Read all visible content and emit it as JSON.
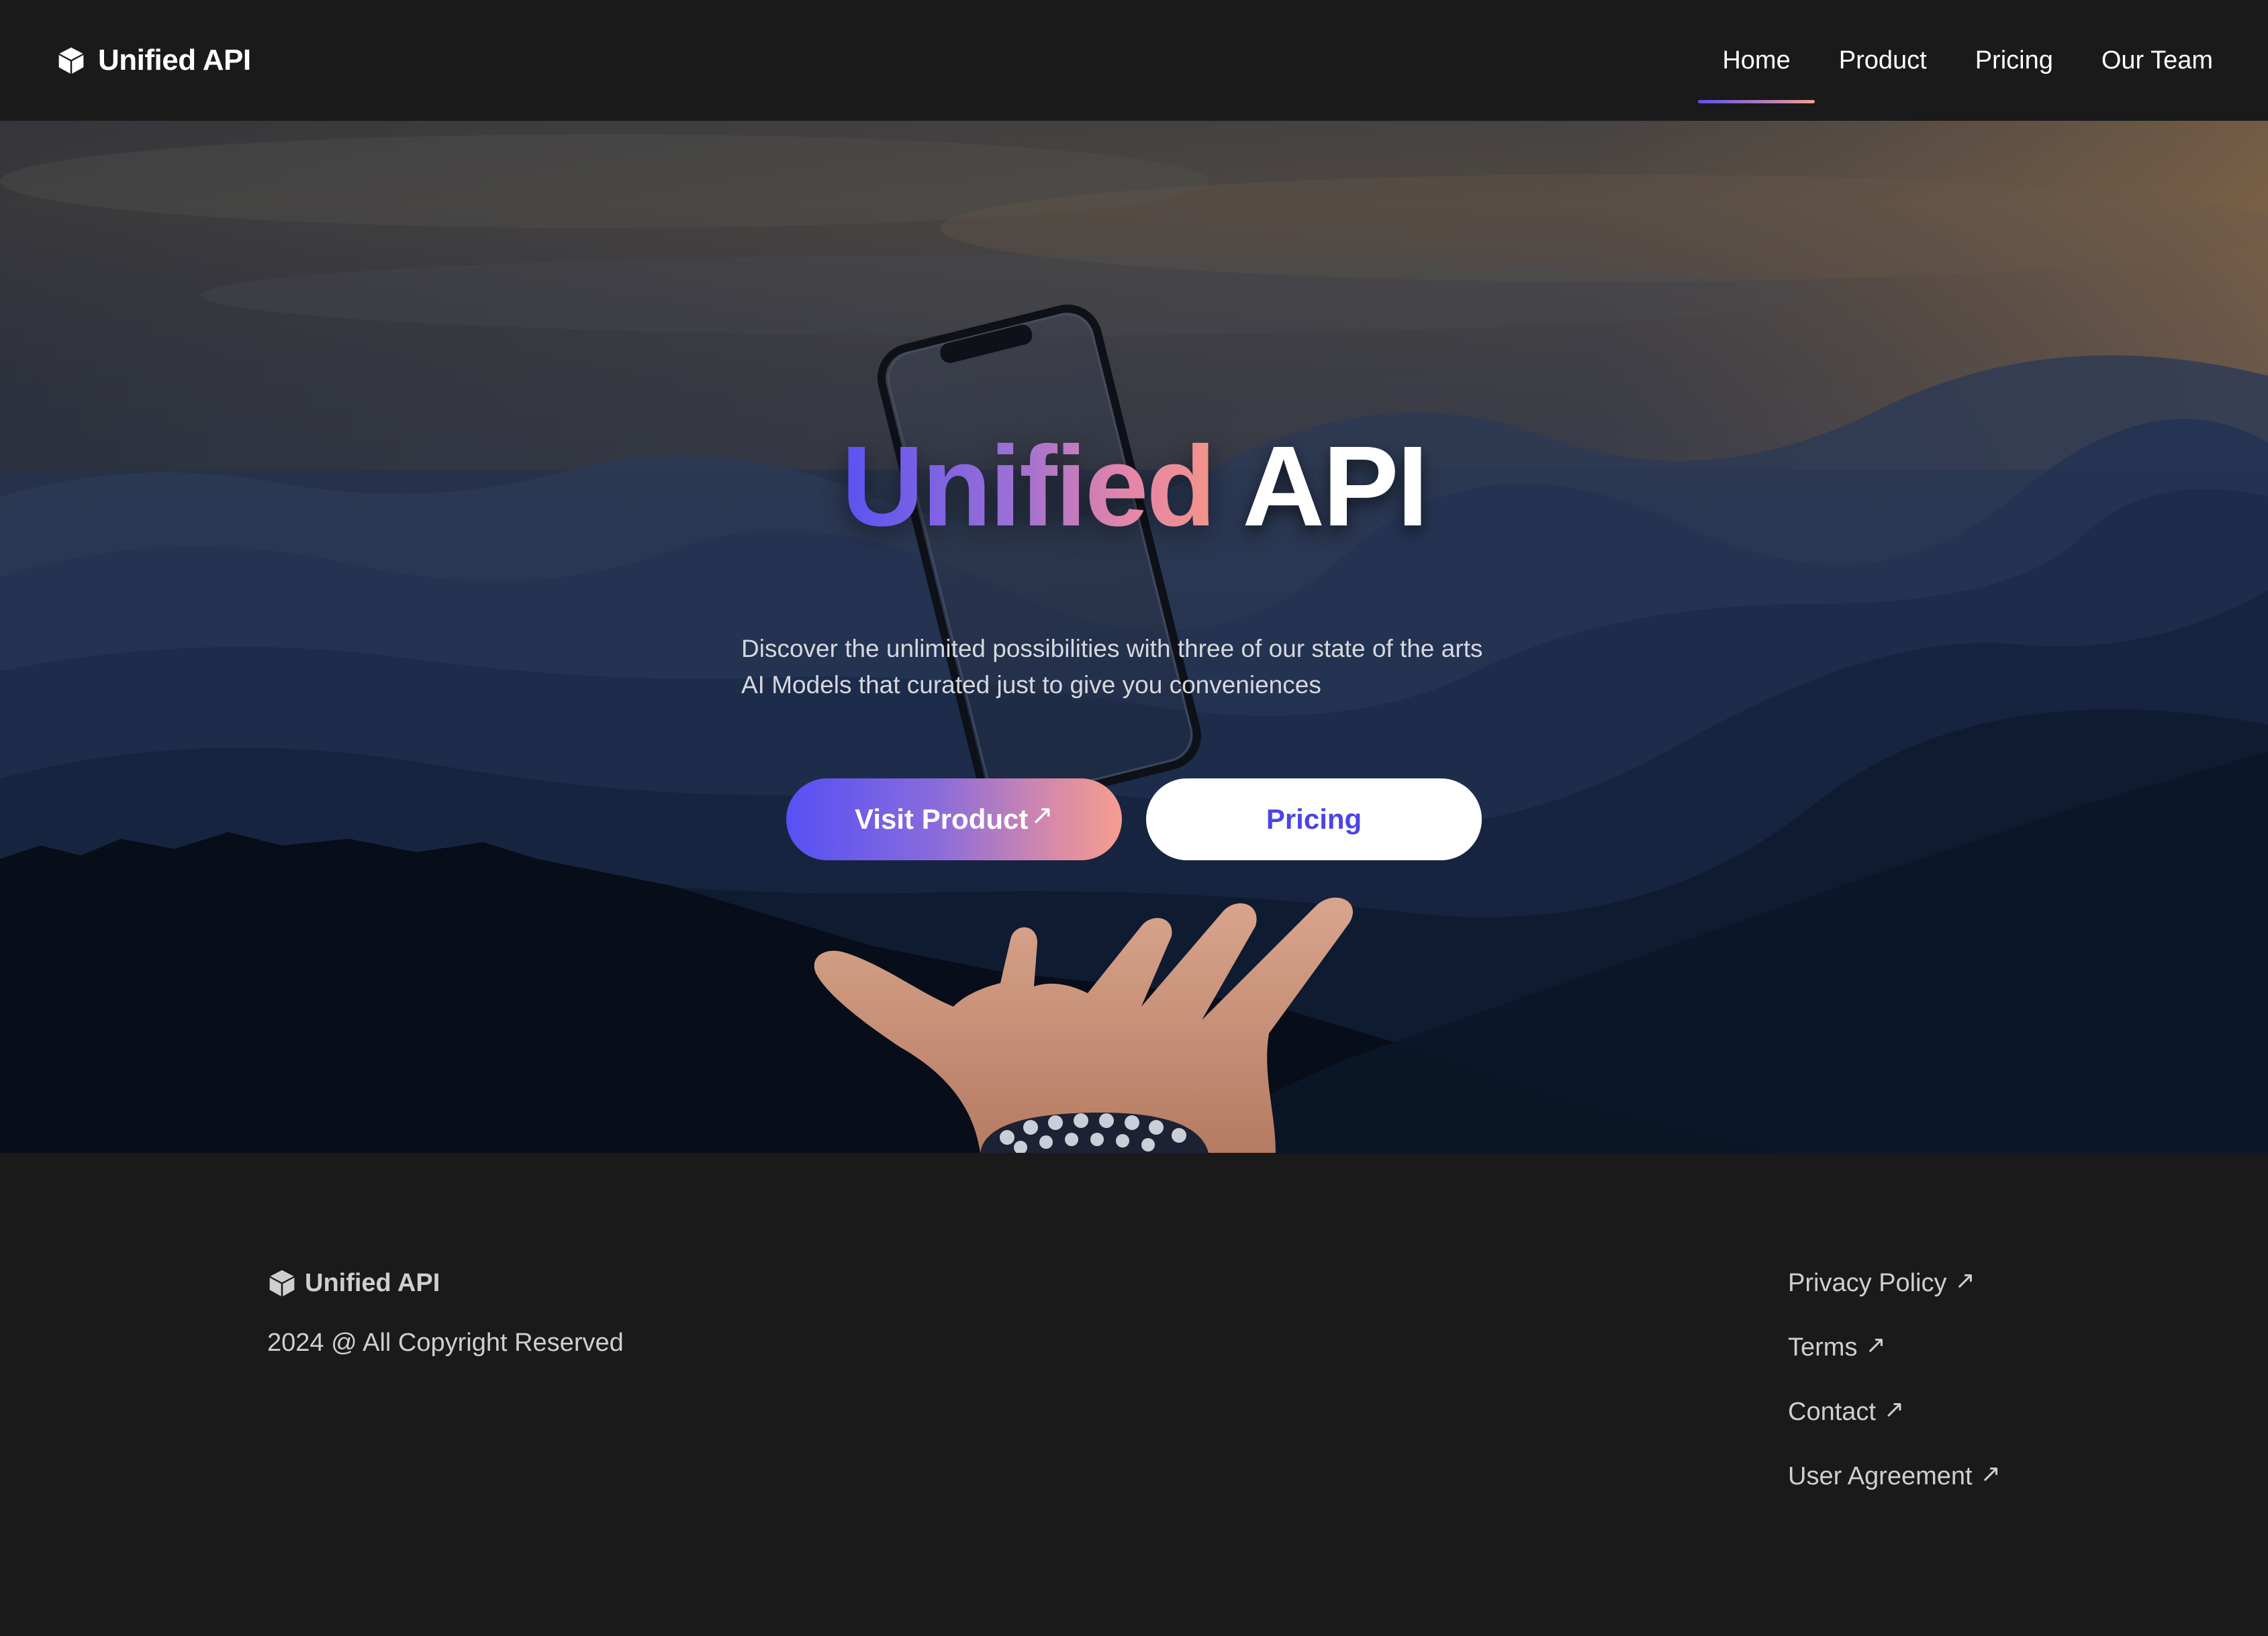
{
  "header": {
    "brand_name": "Unified API",
    "brand_icon": "cube-icon",
    "nav": [
      {
        "label": "Home",
        "active": true
      },
      {
        "label": "Product",
        "active": false
      },
      {
        "label": "Pricing",
        "active": false
      },
      {
        "label": "Our Team",
        "active": false
      }
    ]
  },
  "hero": {
    "title_gradient": "Unified",
    "title_rest": "API",
    "description_line1": "Discover the unlimited possibilities with three of our state of the arts",
    "description_line2": "AI Models that curated just to give you conveniences",
    "primary_button": "Visit Product",
    "primary_button_icon": "arrow-up-right-icon",
    "secondary_button": "Pricing",
    "background_image": "mountains-hand-phone-photo"
  },
  "footer": {
    "brand_name": "Unified API",
    "copyright": "2024 @ All Copyright Reserved",
    "links": [
      {
        "label": "Privacy Policy",
        "icon": "arrow-up-right-icon"
      },
      {
        "label": "Terms",
        "icon": "arrow-up-right-icon"
      },
      {
        "label": "Contact",
        "icon": "arrow-up-right-icon"
      },
      {
        "label": "User Agreement",
        "icon": "arrow-up-right-icon"
      }
    ]
  },
  "colors": {
    "background": "#1a1a1a",
    "accent_start": "#5b52f2",
    "accent_end": "#f4948a",
    "secondary_button_text": "#4b44e6"
  }
}
